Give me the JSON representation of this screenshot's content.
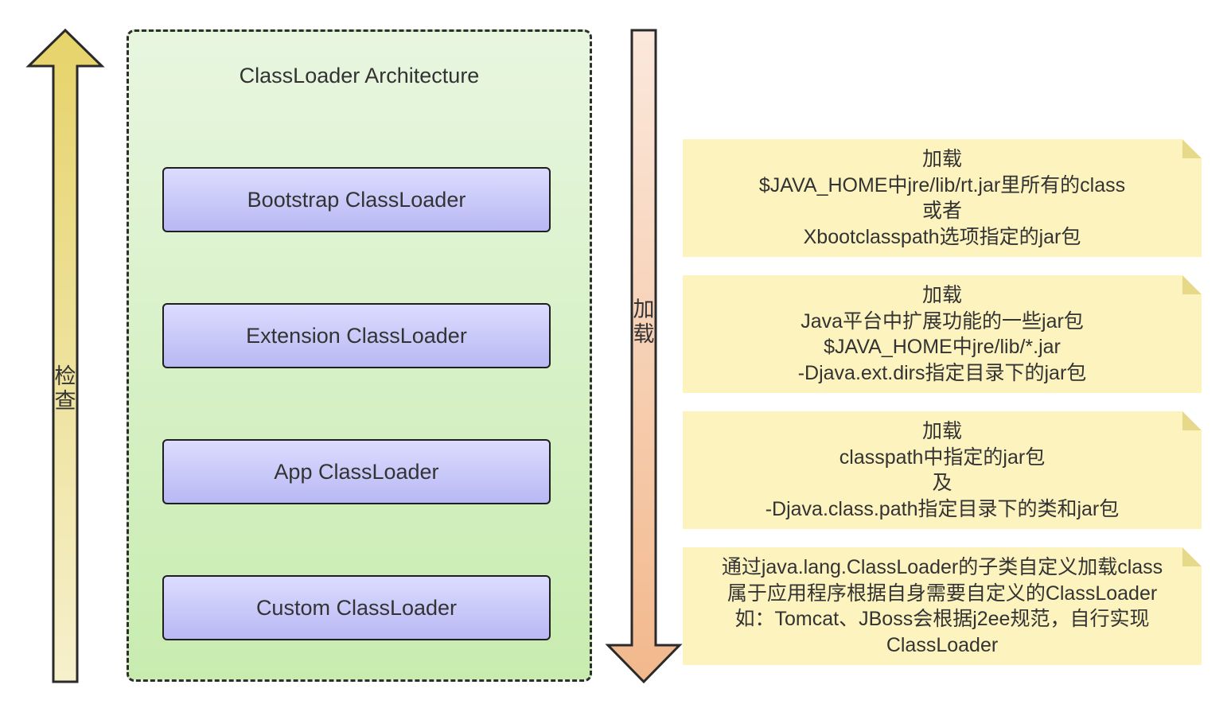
{
  "left_arrow": {
    "label_chars": [
      "检",
      "查"
    ]
  },
  "right_arrow": {
    "label_chars": [
      "加",
      "载"
    ]
  },
  "architecture": {
    "title": "ClassLoader Architecture",
    "loaders": [
      "Bootstrap ClassLoader",
      "Extension ClassLoader",
      "App ClassLoader",
      "Custom ClassLoader"
    ]
  },
  "notes": [
    {
      "lines": [
        "加载",
        "$JAVA_HOME中jre/lib/rt.jar里所有的class",
        "或者",
        "Xbootclasspath选项指定的jar包"
      ]
    },
    {
      "lines": [
        "加载",
        "Java平台中扩展功能的一些jar包",
        "$JAVA_HOME中jre/lib/*.jar",
        "-Djava.ext.dirs指定目录下的jar包"
      ]
    },
    {
      "lines": [
        "加载",
        "classpath中指定的jar包",
        "及",
        "-Djava.class.path指定目录下的类和jar包"
      ]
    },
    {
      "lines": [
        "通过java.lang.ClassLoader的子类自定义加载class",
        "属于应用程序根据自身需要自定义的ClassLoader",
        "如：Tomcat、JBoss会根据j2ee规范，自行实现",
        "ClassLoader"
      ]
    }
  ],
  "colors": {
    "up_arrow_top": "#e6d36a",
    "up_arrow_bottom": "#f6f0cc",
    "down_arrow_top": "#fbe8dc",
    "down_arrow_bottom": "#f2b88c",
    "container_top": "#e8f6e0",
    "container_bottom": "#c8ecb0",
    "loader_top": "#dcdcff",
    "loader_bottom": "#b8b8f4",
    "note_fill": "#fcf3be"
  }
}
